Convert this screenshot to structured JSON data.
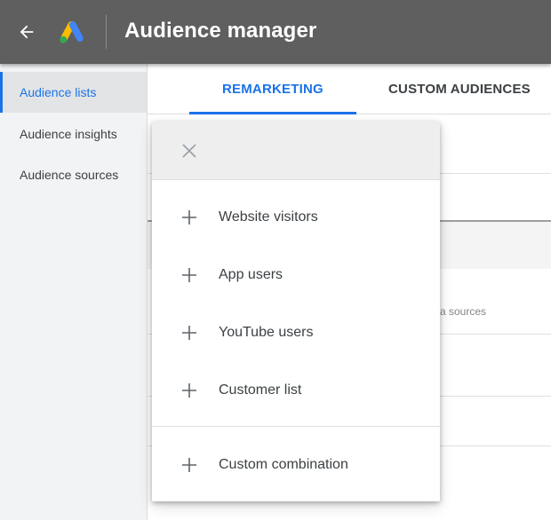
{
  "header": {
    "title": "Audience manager",
    "background": "#5f5f5f",
    "back_icon": "arrow-back-icon",
    "logo_icon": "google-ads-logo"
  },
  "sidebar": {
    "items": [
      {
        "label": "Audience lists",
        "active": true
      },
      {
        "label": "Audience insights",
        "active": false
      },
      {
        "label": "Audience sources",
        "active": false
      }
    ]
  },
  "tabs": [
    {
      "label": "REMARKETING",
      "active": true
    },
    {
      "label": "CUSTOM AUDIENCES",
      "active": false
    }
  ],
  "background_content": {
    "partial_text": "a sources"
  },
  "menu": {
    "close_icon": "close-icon",
    "items": [
      {
        "label": "Website visitors",
        "icon": "plus-icon"
      },
      {
        "label": "App users",
        "icon": "plus-icon"
      },
      {
        "label": "YouTube users",
        "icon": "plus-icon"
      },
      {
        "label": "Customer list",
        "icon": "plus-icon"
      },
      {
        "label": "Custom combination",
        "icon": "plus-icon"
      }
    ]
  },
  "colors": {
    "accent": "#1a73e8",
    "text": "#3c4043",
    "sidebar_bg": "#f1f3f4"
  }
}
